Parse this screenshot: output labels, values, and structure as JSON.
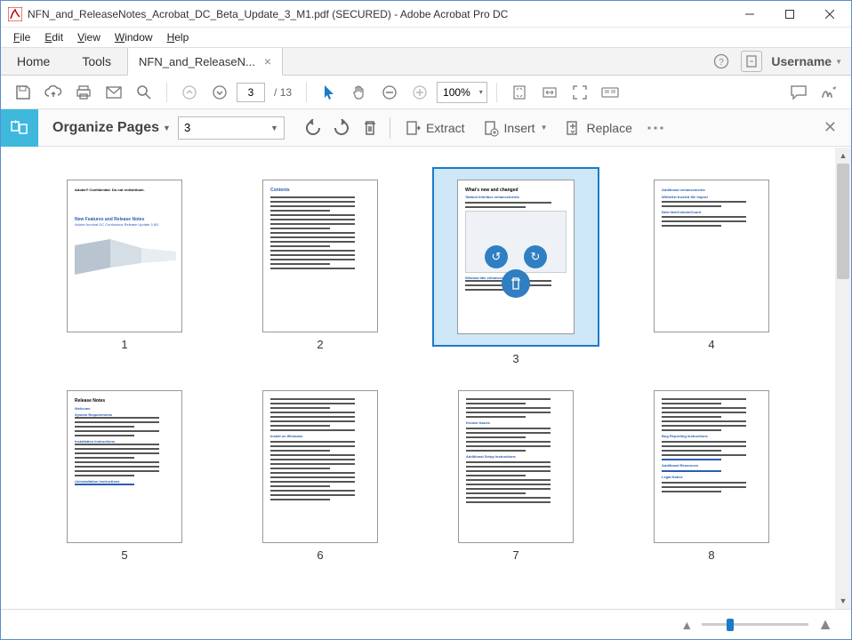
{
  "window": {
    "title": "NFN_and_ReleaseNotes_Acrobat_DC_Beta_Update_3_M1.pdf (SECURED) - Adobe Acrobat Pro DC"
  },
  "menubar": {
    "file": "File",
    "edit": "Edit",
    "view": "View",
    "window": "Window",
    "help": "Help"
  },
  "tabs": {
    "home": "Home",
    "tools": "Tools",
    "file_tab": "NFN_and_ReleaseN...",
    "username": "Username"
  },
  "toolbar": {
    "page_current": "3",
    "page_total_prefix": "/",
    "page_total": "13",
    "zoom": "100%"
  },
  "organize": {
    "title": "Organize Pages",
    "select_value": "3",
    "extract": "Extract",
    "insert": "Insert",
    "replace": "Replace"
  },
  "thumbs": {
    "labels": [
      "1",
      "2",
      "3",
      "4",
      "5",
      "6",
      "7",
      "8"
    ],
    "selected_index": 2
  }
}
